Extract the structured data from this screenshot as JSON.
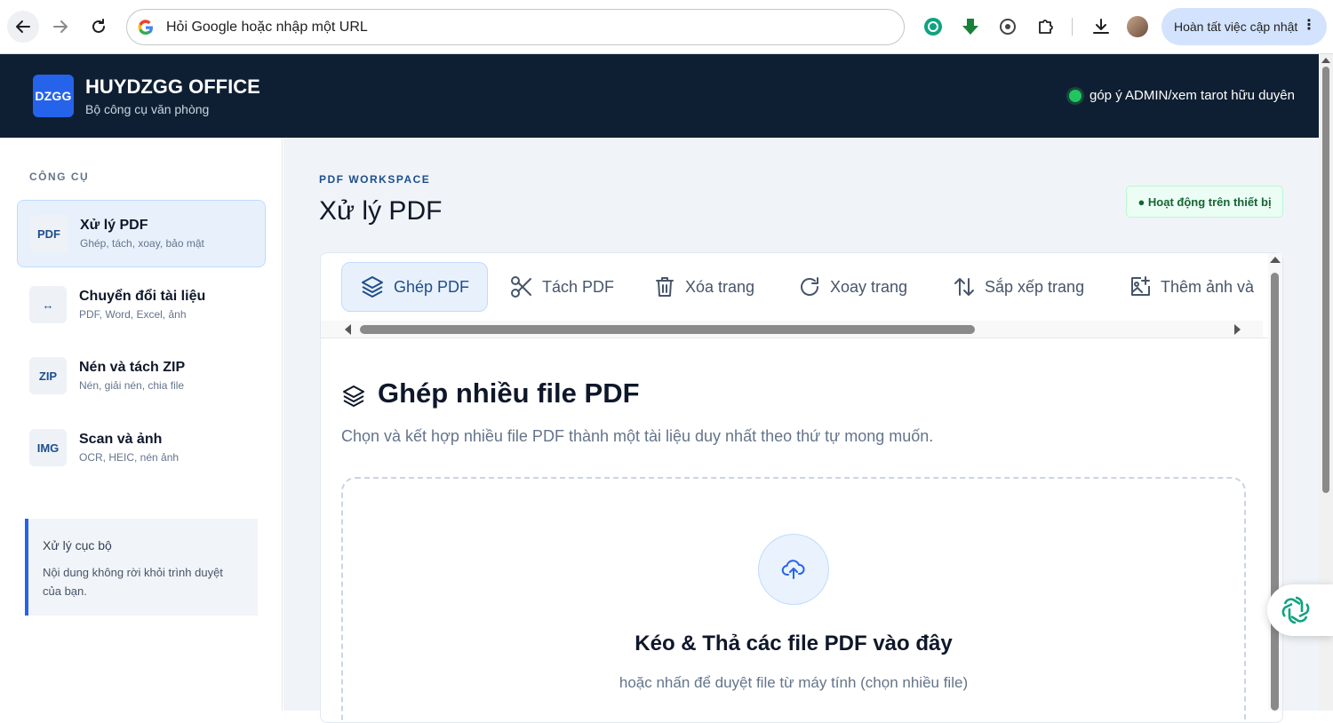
{
  "browser": {
    "omnibox_text": "Hỏi Google hoặc nhập một URL",
    "update_label": "Hoàn tất việc cập nhật"
  },
  "header": {
    "logo": "DZGG",
    "title": "HUYDZGG OFFICE",
    "subtitle": "Bộ công cụ văn phòng",
    "status": "góp ý ADMIN/xem tarot hữu duyên"
  },
  "sidebar": {
    "heading": "CÔNG CỤ",
    "items": [
      {
        "badge": "PDF",
        "title": "Xử lý PDF",
        "desc": "Ghép, tách, xoay, bảo mật"
      },
      {
        "badge": "↔",
        "title": "Chuyển đổi tài liệu",
        "desc": "PDF, Word, Excel, ảnh"
      },
      {
        "badge": "ZIP",
        "title": "Nén và tách ZIP",
        "desc": "Nén, giải nén, chia file"
      },
      {
        "badge": "IMG",
        "title": "Scan và ảnh",
        "desc": "OCR, HEIC, nén ảnh"
      }
    ],
    "note": {
      "title": "Xử lý cục bộ",
      "body": "Nội dung không rời khỏi trình duyệt của bạn."
    }
  },
  "main": {
    "eyebrow": "PDF WORKSPACE",
    "title": "Xử lý PDF",
    "badge": "● Hoạt động trên thiết bị",
    "tabs": [
      {
        "label": "Ghép PDF"
      },
      {
        "label": "Tách PDF"
      },
      {
        "label": "Xóa trang"
      },
      {
        "label": "Xoay trang"
      },
      {
        "label": "Sắp xếp trang"
      },
      {
        "label": "Thêm ảnh và"
      }
    ],
    "section": {
      "title": "Ghép nhiều file PDF",
      "desc": "Chọn và kết hợp nhiều file PDF thành một tài liệu duy nhất theo thứ tự mong muốn."
    },
    "dropzone": {
      "title": "Kéo & Thả các file PDF vào đây",
      "subtitle": "hoặc nhấn để duyệt file từ máy tính (chọn nhiều file)"
    }
  },
  "colors": {
    "header_bg": "#0f1f33",
    "accent": "#2563eb",
    "status_green": "#22c55e"
  }
}
